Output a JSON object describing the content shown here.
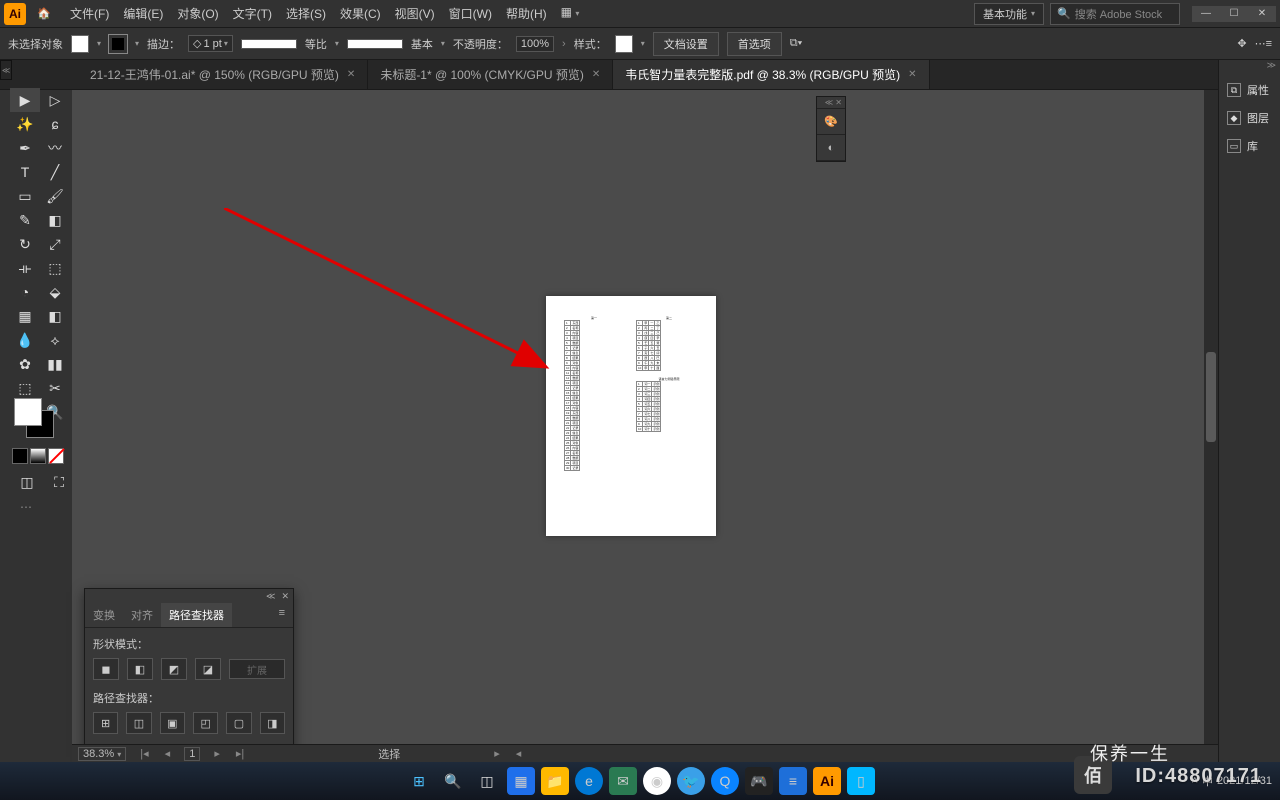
{
  "titlebar": {
    "logo": "Ai",
    "menus": [
      "文件(F)",
      "编辑(E)",
      "对象(O)",
      "文字(T)",
      "选择(S)",
      "效果(C)",
      "视图(V)",
      "窗口(W)",
      "帮助(H)"
    ],
    "workspace": "基本功能",
    "search_placeholder": "搜索 Adobe Stock"
  },
  "optbar": {
    "selection": "未选择对象",
    "stroke_label": "描边：",
    "stroke_pt": "1 pt",
    "uniform": "等比",
    "basic": "基本",
    "opacity_label": "不透明度：",
    "opacity_value": "100%",
    "style_label": "样式：",
    "doc_setup": "文档设置",
    "prefs": "首选项"
  },
  "tabs": [
    {
      "label": "21-12-王鸿伟-01.ai* @ 150% (RGB/GPU 预览)",
      "active": false
    },
    {
      "label": "未标题-1* @ 100% (CMYK/GPU 预览)",
      "active": false
    },
    {
      "label": "韦氏智力量表完整版.pdf @ 38.3% (RGB/GPU 预览)",
      "active": true
    }
  ],
  "right_panels": [
    {
      "icon": "⧉",
      "label": "属性"
    },
    {
      "icon": "◆",
      "label": "图层"
    },
    {
      "icon": "▭",
      "label": "库"
    }
  ],
  "pathfinder": {
    "tabs": [
      "变换",
      "对齐",
      "路径查找器"
    ],
    "shape_modes": "形状模式：",
    "expand": "扩展",
    "pathfinders": "路径查找器："
  },
  "status": {
    "zoom": "38.3%",
    "artboard": "1",
    "tool": "选择"
  },
  "taskbar": {
    "date": "2021/12/31",
    "lang": "中"
  },
  "watermark": {
    "brand": "保养一生",
    "id": "ID:48807171"
  },
  "tools_left": [
    "▸",
    "▹",
    "✦",
    "✎",
    "T",
    "╱",
    "▢",
    "✂",
    "◧",
    "↻",
    "⟲",
    "⬒",
    "◫",
    "⋰",
    "▥",
    "⊞",
    "✎",
    "⌁",
    "✋",
    "⌕"
  ],
  "colors": {
    "white": "#ffffff",
    "black": "#000000",
    "none": "#ff0000"
  }
}
